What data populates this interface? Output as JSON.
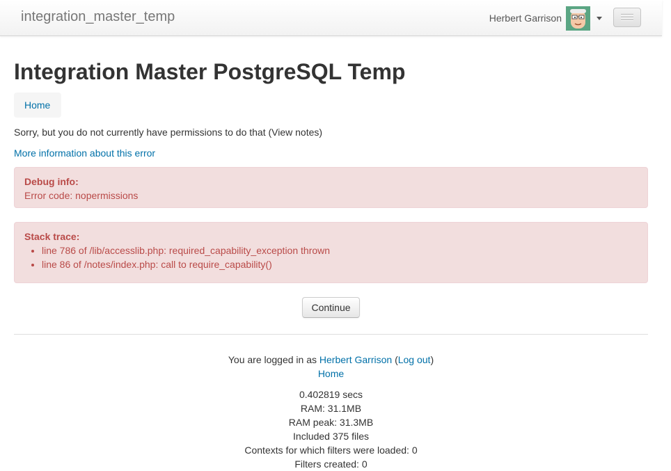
{
  "navbar": {
    "brand": "integration_master_temp",
    "user_name": "Herbert Garrison"
  },
  "page": {
    "heading": "Integration Master PostgreSQL Temp",
    "breadcrumb_home": "Home",
    "error_message": "Sorry, but you do not currently have permissions to do that (View notes)",
    "more_info_link": "More information about this error"
  },
  "debug": {
    "title": "Debug info:",
    "error_code": "Error code: nopermissions"
  },
  "stack": {
    "title": "Stack trace:",
    "lines": [
      "line 786 of /lib/accesslib.php: required_capability_exception thrown",
      "line 86 of /notes/index.php: call to require_capability()"
    ]
  },
  "continue_label": "Continue",
  "footer": {
    "logged_in_prefix": "You are logged in as",
    "user_name": "Herbert Garrison",
    "logout_label": "Log out",
    "home_label": "Home",
    "perf": [
      "0.402819 secs",
      "RAM: 31.1MB",
      "RAM peak: 31.3MB",
      "Included 375 files",
      "Contexts for which filters were loaded: 0",
      "Filters created: 0"
    ]
  }
}
